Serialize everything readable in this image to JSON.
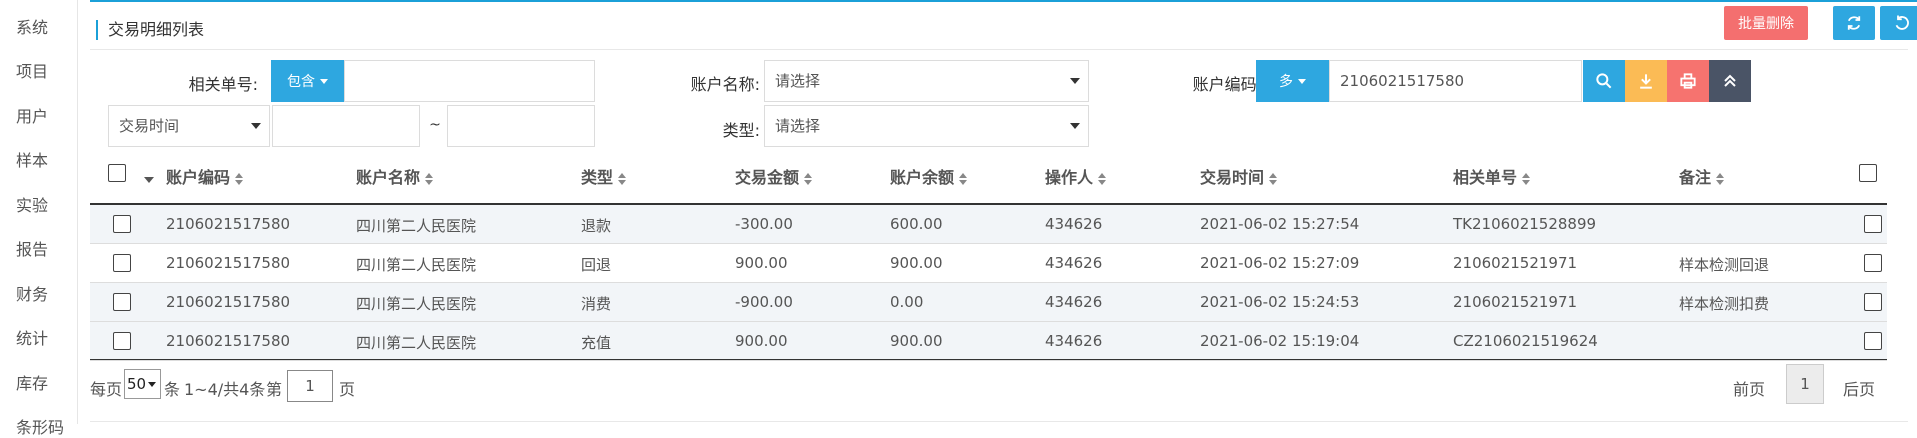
{
  "sidebar": {
    "items": [
      "系统",
      "项目",
      "用户",
      "样本",
      "实验",
      "报告",
      "财务",
      "统计",
      "库存",
      "条形码"
    ]
  },
  "panel": {
    "title": "交易明细列表",
    "batch_delete": "批量删除",
    "refresh_icon": "refresh-icon",
    "back_icon": "back-icon"
  },
  "search": {
    "ref_no_label": "相关单号:",
    "ref_no_mode": "包含",
    "ref_no_value": "",
    "account_name_label": "账户名称:",
    "account_name_value": "请选择",
    "account_code_label": "账户编码:",
    "account_code_mode": "多",
    "account_code_value": "2106021517580",
    "time_field": "交易时间",
    "time_start": "",
    "time_sep": "~",
    "time_end": "",
    "type_label": "类型:",
    "type_value": "请选择"
  },
  "colors": {
    "primary": "#2ea7e0",
    "danger": "#f46f6f",
    "warning": "#fbbb55",
    "print": "#f6736f",
    "dark": "#4a5466"
  },
  "table": {
    "headers": [
      "账户编码",
      "账户名称",
      "类型",
      "交易金额",
      "账户余额",
      "操作人",
      "交易时间",
      "相关单号",
      "备注"
    ],
    "rows": [
      [
        "2106021517580",
        "四川第二人民医院",
        "退款",
        "-300.00",
        "600.00",
        "434626",
        "2021-06-02 15:27:54",
        "TK2106021528899",
        ""
      ],
      [
        "2106021517580",
        "四川第二人民医院",
        "回退",
        "900.00",
        "900.00",
        "434626",
        "2021-06-02 15:27:09",
        "2106021521971",
        "样本检测回退"
      ],
      [
        "2106021517580",
        "四川第二人民医院",
        "消费",
        "-900.00",
        "0.00",
        "434626",
        "2021-06-02 15:24:53",
        "2106021521971",
        "样本检测扣费"
      ],
      [
        "2106021517580",
        "四川第二人民医院",
        "充值",
        "900.00",
        "900.00",
        "434626",
        "2021-06-02 15:19:04",
        "CZ2106021519624",
        ""
      ]
    ]
  },
  "pagination": {
    "per_page_prefix": "每页",
    "per_page": "50",
    "per_page_suffix": "条",
    "range": "1~4/共4条",
    "page_prefix": "第",
    "page": "1",
    "page_suffix": "页",
    "prev": "前页",
    "current": "1",
    "next": "后页"
  }
}
